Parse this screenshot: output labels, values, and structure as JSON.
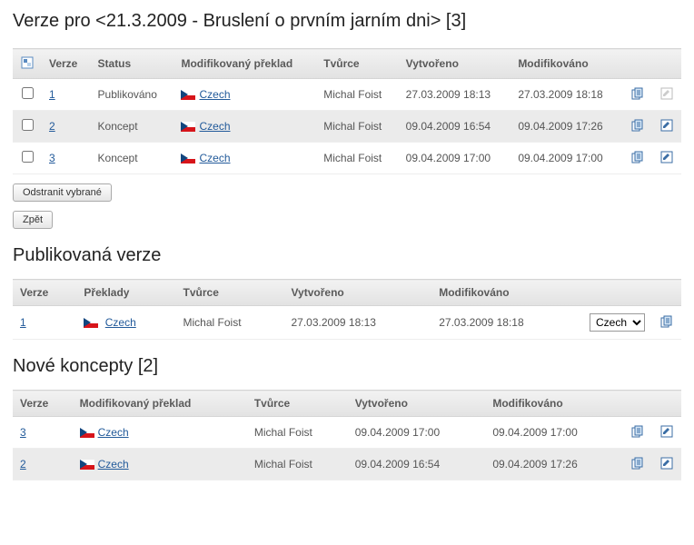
{
  "heading": "Verze pro <21.3.2009 - Bruslení o prvním jarním dni> [3]",
  "table1": {
    "headers": {
      "verze": "Verze",
      "status": "Status",
      "mod_preklad": "Modifikovaný překlad",
      "tvurce": "Tvůrce",
      "vytvoreno": "Vytvořeno",
      "modifikovano": "Modifikováno"
    },
    "rows": [
      {
        "verze": "1",
        "status": "Publikováno",
        "lang": "Czech",
        "tvurce": "Michal Foist",
        "vytvoreno": "27.03.2009 18:13",
        "modifikovano": "27.03.2009 18:18",
        "editable": false
      },
      {
        "verze": "2",
        "status": "Koncept",
        "lang": "Czech",
        "tvurce": "Michal Foist",
        "vytvoreno": "09.04.2009 16:54",
        "modifikovano": "09.04.2009 17:26",
        "editable": true
      },
      {
        "verze": "3",
        "status": "Koncept",
        "lang": "Czech",
        "tvurce": "Michal Foist",
        "vytvoreno": "09.04.2009 17:00",
        "modifikovano": "09.04.2009 17:00",
        "editable": true
      }
    ]
  },
  "buttons": {
    "remove_selected": "Odstranit vybrané",
    "back": "Zpět"
  },
  "heading2": "Publikovaná verze",
  "table2": {
    "headers": {
      "verze": "Verze",
      "preklady": "Překlady",
      "tvurce": "Tvůrce",
      "vytvoreno": "Vytvořeno",
      "modifikovano": "Modifikováno"
    },
    "row": {
      "verze": "1",
      "lang": "Czech",
      "tvurce": "Michal Foist",
      "vytvoreno": "27.03.2009 18:13",
      "modifikovano": "27.03.2009 18:18"
    },
    "select_value": "Czech"
  },
  "heading3": "Nové koncepty [2]",
  "table3": {
    "headers": {
      "verze": "Verze",
      "mod_preklad": "Modifikovaný překlad",
      "tvurce": "Tvůrce",
      "vytvoreno": "Vytvořeno",
      "modifikovano": "Modifikováno"
    },
    "rows": [
      {
        "verze": "3",
        "lang": "Czech",
        "tvurce": "Michal Foist",
        "vytvoreno": "09.04.2009 17:00",
        "modifikovano": "09.04.2009 17:00"
      },
      {
        "verze": "2",
        "lang": "Czech",
        "tvurce": "Michal Foist",
        "vytvoreno": "09.04.2009 16:54",
        "modifikovano": "09.04.2009 17:26"
      }
    ]
  }
}
